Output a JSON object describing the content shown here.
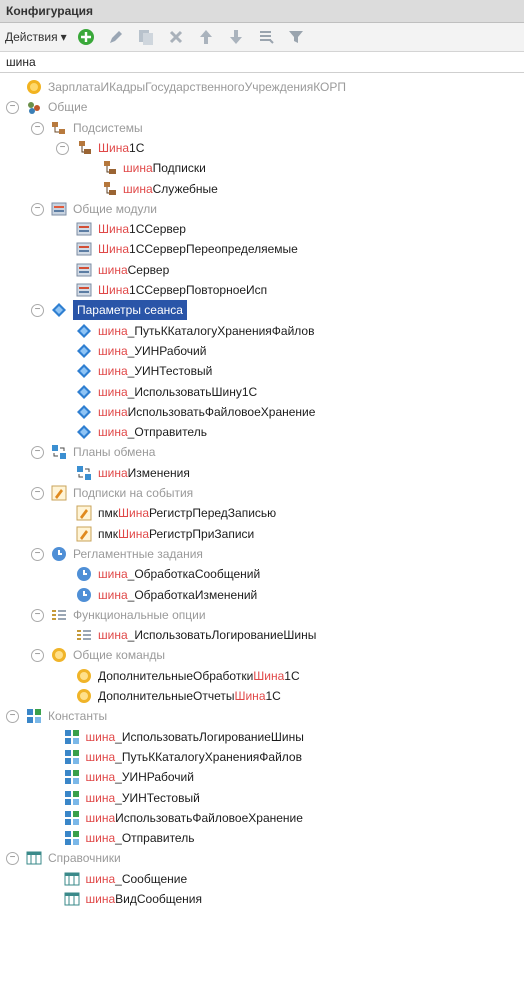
{
  "window": {
    "title": "Конфигурация"
  },
  "toolbar": {
    "actions_label": "Действия",
    "buttons": [
      "add-icon",
      "edit-icon",
      "copy-icon",
      "delete-icon",
      "move-up-icon",
      "move-down-icon",
      "list-icon",
      "filter-icon"
    ]
  },
  "search": {
    "value": "шина"
  },
  "tree": [
    {
      "level": 0,
      "expander": false,
      "icon": "root-config-icon",
      "text": "ЗарплатаИКадрыГосударственногоУчрежденияКОРП",
      "style": "grp"
    },
    {
      "level": 0,
      "expander": true,
      "icon": "common-icon",
      "text": "Общие",
      "style": "grp"
    },
    {
      "level": 1,
      "expander": true,
      "icon": "subsystems-icon",
      "text": "Подсистемы",
      "style": "grp"
    },
    {
      "level": 2,
      "expander": true,
      "icon": "subsystem-icon",
      "hl": "Шина",
      "text": "1С",
      "style": "item"
    },
    {
      "level": 3,
      "expander": false,
      "icon": "subsystem-icon",
      "hl": "шина",
      "text": "Подписки",
      "style": "item"
    },
    {
      "level": 3,
      "expander": false,
      "icon": "subsystem-icon",
      "hl": "шина",
      "text": "Служебные",
      "style": "item"
    },
    {
      "level": 1,
      "expander": true,
      "icon": "common-modules-icon",
      "text": "Общие модули",
      "style": "grp"
    },
    {
      "level": 2,
      "expander": false,
      "icon": "module-icon",
      "hl": "Шина",
      "text": "1ССервер",
      "style": "item"
    },
    {
      "level": 2,
      "expander": false,
      "icon": "module-icon",
      "hl": "Шина",
      "text": "1ССерверПереопределяемые",
      "style": "item"
    },
    {
      "level": 2,
      "expander": false,
      "icon": "module-icon",
      "hl": "шина",
      "text": "Сервер",
      "style": "item"
    },
    {
      "level": 2,
      "expander": false,
      "icon": "module-icon",
      "hl": "Шина",
      "text": "1ССерверПовторноеИсп",
      "style": "item"
    },
    {
      "level": 1,
      "expander": true,
      "icon": "session-params-icon",
      "text": "Параметры сеанса",
      "style": "sel"
    },
    {
      "level": 2,
      "expander": false,
      "icon": "session-param-icon",
      "hl": "шина",
      "text": "_ПутьККаталогуХраненияФайлов",
      "style": "item"
    },
    {
      "level": 2,
      "expander": false,
      "icon": "session-param-icon",
      "hl": "шина",
      "text": "_УИНРабочий",
      "style": "item"
    },
    {
      "level": 2,
      "expander": false,
      "icon": "session-param-icon",
      "hl": "шина",
      "text": "_УИНТестовый",
      "style": "item"
    },
    {
      "level": 2,
      "expander": false,
      "icon": "session-param-icon",
      "hl": "шина",
      "text": "_ИспользоватьШину1С",
      "style": "item"
    },
    {
      "level": 2,
      "expander": false,
      "icon": "session-param-icon",
      "hl": "шина",
      "text": "ИспользоватьФайловоеХранение",
      "style": "item"
    },
    {
      "level": 2,
      "expander": false,
      "icon": "session-param-icon",
      "hl": "шина",
      "text": "_Отправитель",
      "style": "item"
    },
    {
      "level": 1,
      "expander": true,
      "icon": "exchange-plans-icon",
      "text": "Планы обмена",
      "style": "grp"
    },
    {
      "level": 2,
      "expander": false,
      "icon": "exchange-plan-icon",
      "hl": "шина",
      "text": "Изменения",
      "style": "item"
    },
    {
      "level": 1,
      "expander": true,
      "icon": "event-subscriptions-icon",
      "text": "Подписки на события",
      "style": "grp"
    },
    {
      "level": 2,
      "expander": false,
      "icon": "event-subscription-icon",
      "pre": "пмк",
      "hl": "Шина",
      "text": "РегистрПередЗаписью",
      "style": "item"
    },
    {
      "level": 2,
      "expander": false,
      "icon": "event-subscription-icon",
      "pre": "пмк",
      "hl": "Шина",
      "text": "РегистрПриЗаписи",
      "style": "item"
    },
    {
      "level": 1,
      "expander": true,
      "icon": "scheduled-jobs-icon",
      "text": "Регламентные задания",
      "style": "grp"
    },
    {
      "level": 2,
      "expander": false,
      "icon": "scheduled-job-icon",
      "hl": "шина",
      "text": "_ОбработкаСообщений",
      "style": "item"
    },
    {
      "level": 2,
      "expander": false,
      "icon": "scheduled-job-icon",
      "hl": "шина",
      "text": "_ОбработкаИзменений",
      "style": "item"
    },
    {
      "level": 1,
      "expander": true,
      "icon": "functional-options-icon",
      "text": "Функциональные опции",
      "style": "grp"
    },
    {
      "level": 2,
      "expander": false,
      "icon": "functional-option-icon",
      "hl": "шина",
      "text": "_ИспользоватьЛогированиеШины",
      "style": "item"
    },
    {
      "level": 1,
      "expander": true,
      "icon": "common-commands-icon",
      "text": "Общие команды",
      "style": "grp"
    },
    {
      "level": 2,
      "expander": false,
      "icon": "common-command-icon",
      "pre": "ДополнительныеОбработки",
      "hl": "Шина",
      "text": "1С",
      "style": "item"
    },
    {
      "level": 2,
      "expander": false,
      "icon": "common-command-icon",
      "pre": "ДополнительныеОтчеты",
      "hl": "Шина",
      "text": "1С",
      "style": "item"
    },
    {
      "level": 0,
      "expander": true,
      "icon": "constants-icon",
      "text": "Константы",
      "style": "grp"
    },
    {
      "level": 1.5,
      "expander": false,
      "icon": "constant-icon",
      "hl": "шина",
      "text": "_ИспользоватьЛогированиеШины",
      "style": "item"
    },
    {
      "level": 1.5,
      "expander": false,
      "icon": "constant-icon",
      "hl": "шина",
      "text": "_ПутьККаталогуХраненияФайлов",
      "style": "item"
    },
    {
      "level": 1.5,
      "expander": false,
      "icon": "constant-icon",
      "hl": "шина",
      "text": "_УИНРабочий",
      "style": "item"
    },
    {
      "level": 1.5,
      "expander": false,
      "icon": "constant-icon",
      "hl": "шина",
      "text": "_УИНТестовый",
      "style": "item"
    },
    {
      "level": 1.5,
      "expander": false,
      "icon": "constant-icon",
      "hl": "шина",
      "text": "ИспользоватьФайловоеХранение",
      "style": "item"
    },
    {
      "level": 1.5,
      "expander": false,
      "icon": "constant-icon",
      "hl": "шина",
      "text": "_Отправитель",
      "style": "item"
    },
    {
      "level": 0,
      "expander": true,
      "icon": "catalogs-icon",
      "text": "Справочники",
      "style": "grp"
    },
    {
      "level": 1.5,
      "expander": false,
      "icon": "catalog-icon",
      "hl": "шина",
      "text": "_Сообщение",
      "style": "item"
    },
    {
      "level": 1.5,
      "expander": false,
      "icon": "catalog-icon",
      "hl": "шина",
      "text": "ВидСообщения",
      "style": "item"
    }
  ]
}
